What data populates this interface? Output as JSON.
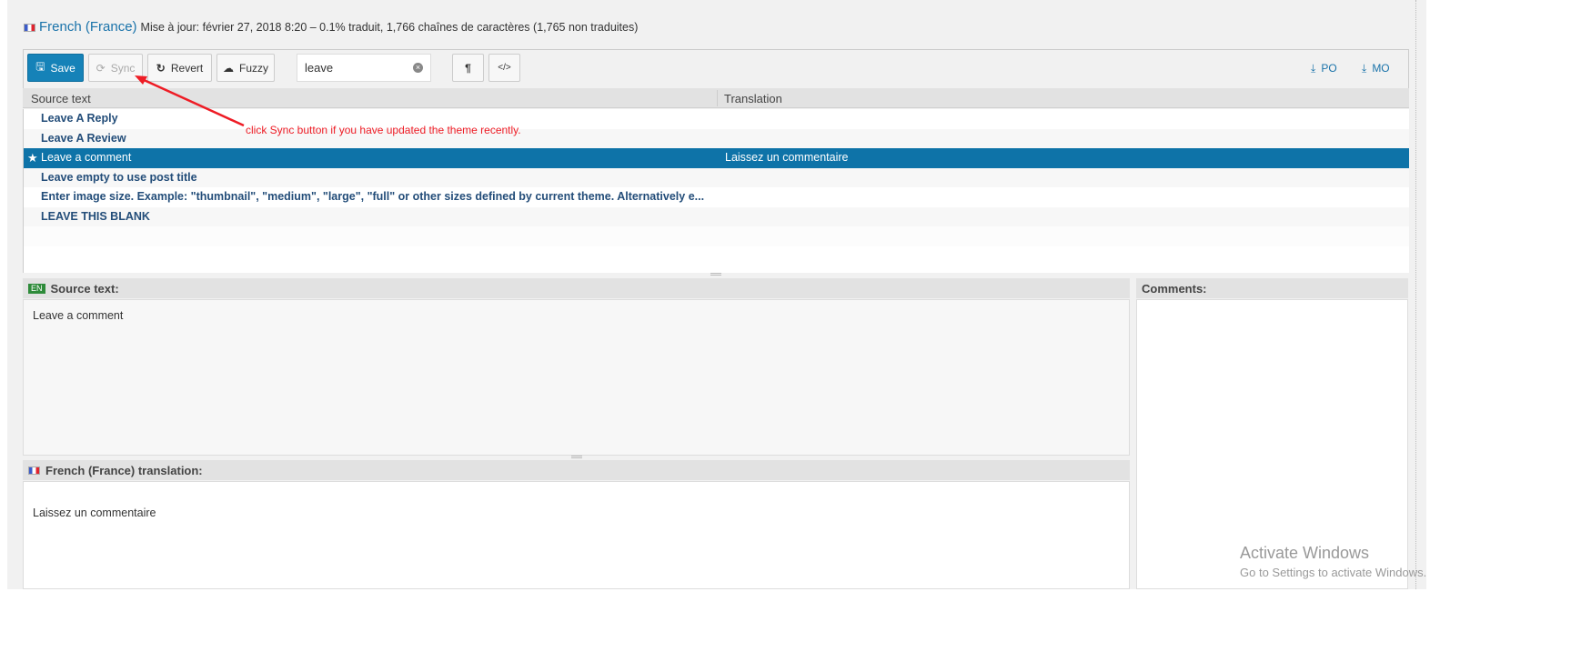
{
  "header": {
    "language": "French (France)",
    "status": "Mise à jour: février 27, 2018 8:20 – 0.1% traduit, 1,766 chaînes de caractères (1,765 non traduites)"
  },
  "toolbar": {
    "save": "Save",
    "sync": "Sync",
    "revert": "Revert",
    "fuzzy": "Fuzzy",
    "search_value": "leave",
    "pilcrow": "¶",
    "code": "</>",
    "po": "PO",
    "mo": "MO"
  },
  "columns": {
    "source": "Source text",
    "translation": "Translation"
  },
  "rows": [
    {
      "source": "Leave A Reply",
      "translation": ""
    },
    {
      "source": "Leave A Review",
      "translation": ""
    },
    {
      "source": "Leave a comment",
      "translation": "Laissez un commentaire",
      "selected": true
    },
    {
      "source": "Leave empty to use post title",
      "translation": ""
    },
    {
      "source": "Enter image size. Example: \"thumbnail\", \"medium\", \"large\", \"full\" or other sizes defined by current theme. Alternatively e...",
      "translation": ""
    },
    {
      "source": "LEAVE THIS BLANK",
      "translation": ""
    }
  ],
  "source_panel": {
    "badge": "EN",
    "title": "Source text:",
    "text": "Leave a comment"
  },
  "translation_panel": {
    "title": "French (France) translation:",
    "text": "Laissez un commentaire"
  },
  "comments_panel": {
    "title": "Comments:"
  },
  "annotation": "click Sync button if you have updated the theme recently.",
  "watermark": {
    "title": "Activate Windows",
    "subtitle": "Go to Settings to activate Windows."
  },
  "colors": {
    "accent": "#1582b8",
    "selected_row": "#0e73a8",
    "annotation": "#ee1c25"
  }
}
